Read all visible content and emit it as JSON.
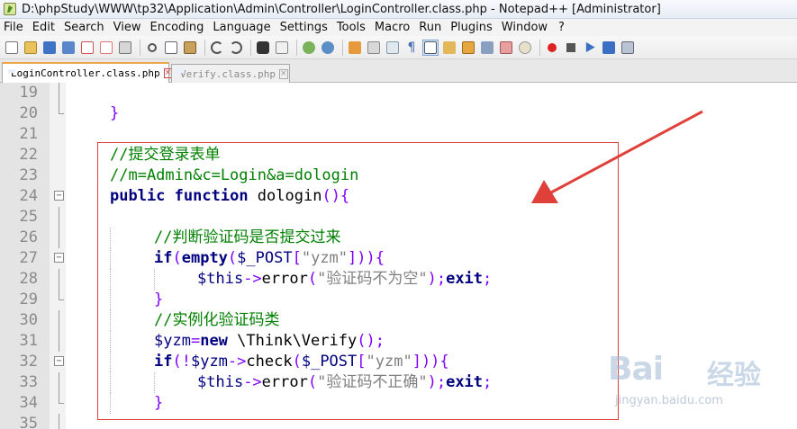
{
  "window": {
    "title": "D:\\phpStudy\\WWW\\tp32\\Application\\Admin\\Controller\\LoginController.class.php - Notepad++ [Administrator]"
  },
  "menu": [
    "File",
    "Edit",
    "Search",
    "View",
    "Encoding",
    "Language",
    "Settings",
    "Tools",
    "Macro",
    "Run",
    "Plugins",
    "Window",
    "?"
  ],
  "tabs": [
    {
      "label": "LoginController.class.php",
      "active": true
    },
    {
      "label": "Verify.class.php",
      "active": false
    }
  ],
  "lines": [
    "19",
    "20",
    "21",
    "22",
    "23",
    "24",
    "25",
    "26",
    "27",
    "28",
    "29",
    "30",
    "31",
    "32",
    "33",
    "34",
    "35"
  ],
  "code": {
    "l20_brace": "}",
    "l22": "//提交登录表单",
    "l23": "//m=Admin&c=Login&a=dologin",
    "l24_public": "public",
    "l24_function": "function",
    "l24_name": " dologin",
    "l24_rest": "(){",
    "l26": "//判断验证码是否提交过来",
    "l27_if": "if",
    "l27_paren": "(",
    "l27_empty": "empty",
    "l27_a": "(",
    "l27_var": "$_POST",
    "l27_b": "[",
    "l27_str": "\"yzm\"",
    "l27_c": "])){",
    "l28_this": "$this",
    "l28_arrow": "->",
    "l28_fn": "error",
    "l28_a": "(",
    "l28_str": "\"验证码不为空\"",
    "l28_b": ");",
    "l28_exit": "exit",
    "l28_semi": ";",
    "l29_brace": "}",
    "l30": "//实例化验证码类",
    "l31_var": "$yzm",
    "l31_eq": "=",
    "l31_new": "new",
    "l31_cls": " \\Think\\Verify",
    "l31_end": "();",
    "l32_if": "if",
    "l32_a": "(!",
    "l32_var": "$yzm",
    "l32_arrow": "->",
    "l32_fn": "check",
    "l32_b": "(",
    "l32_post": "$_POST",
    "l32_c": "[",
    "l32_str": "\"yzm\"",
    "l32_d": "])){",
    "l33_this": "$this",
    "l33_arrow": "->",
    "l33_fn": "error",
    "l33_a": "(",
    "l33_str": "\"验证码不正确\"",
    "l33_b": ");",
    "l33_exit": "exit",
    "l33_semi": ";",
    "l34_brace": "}"
  },
  "watermark": {
    "brand": "Bai",
    "cn": "经验",
    "url": "jingyan.baidu.com"
  },
  "colors": {
    "comment": "#008000",
    "keyword": "#00007f",
    "operator": "#8000ff",
    "string": "#808080",
    "annotation": "#e0403a"
  }
}
